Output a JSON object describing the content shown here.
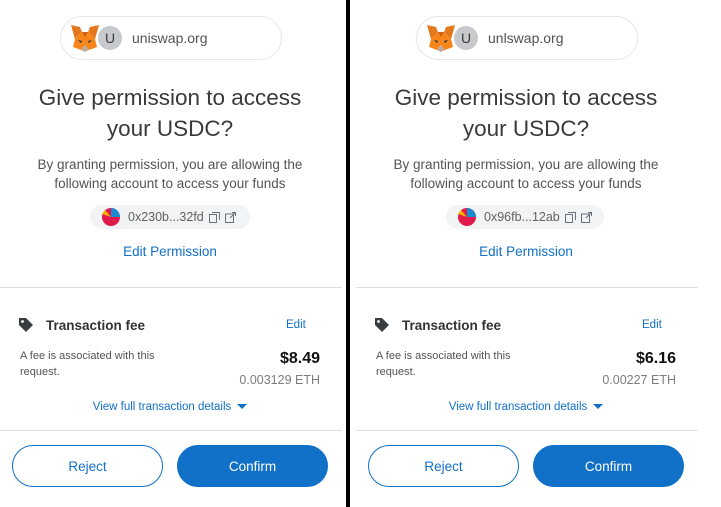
{
  "panels": [
    {
      "site": {
        "avatar_letter": "U",
        "url": "uniswap.org"
      },
      "title": "Give permission to access your USDC?",
      "subtitle": "By granting permission, you are allowing the following account to access your funds",
      "account": {
        "address": "0x230b...32fd"
      },
      "edit_permission_label": "Edit Permission",
      "fee": {
        "title": "Transaction fee",
        "edit_label": "Edit",
        "description": "A fee is associated with this request.",
        "usd": "$8.49",
        "eth": "0.003129 ETH"
      },
      "view_details_label": "View full transaction details",
      "reject_label": "Reject",
      "confirm_label": "Confirm"
    },
    {
      "site": {
        "avatar_letter": "U",
        "url": "unlswap.org"
      },
      "title": "Give permission to access your USDC?",
      "subtitle": "By granting permission, you are allowing the following account to access your funds",
      "account": {
        "address": "0x96fb...12ab"
      },
      "edit_permission_label": "Edit Permission",
      "fee": {
        "title": "Transaction fee",
        "edit_label": "Edit",
        "description": "A fee is associated with this request.",
        "usd": "$6.16",
        "eth": "0.00227 ETH"
      },
      "view_details_label": "View full transaction details",
      "reject_label": "Reject",
      "confirm_label": "Confirm"
    }
  ],
  "colors": {
    "accent": "#1170c7",
    "divider": "#000000",
    "fox_orange": "#e2761b"
  },
  "icons": [
    "metamask-fox-icon",
    "site-avatar-icon",
    "identicon-icon",
    "copy-icon",
    "external-link-icon",
    "tag-icon",
    "chevron-down-icon"
  ]
}
